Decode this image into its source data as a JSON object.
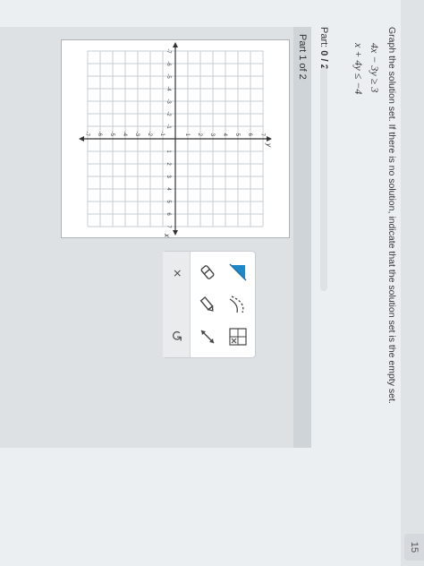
{
  "header": {
    "page_number": "15"
  },
  "question": {
    "instruction": "Graph the solution set. If there is no solution, indicate that the solution set is the empty set.",
    "inequality_1": "4x − 3y ≥ 3",
    "inequality_2": "x + 4y ≤ −4"
  },
  "part": {
    "label": "Part:",
    "progress": "0 / 2",
    "progress_fraction": 0,
    "current": "Part 1 of 2"
  },
  "graph": {
    "x_axis_label": "x",
    "y_axis_label": "y",
    "x_ticks": [
      "-7",
      "-6",
      "-5",
      "-4",
      "-3",
      "-2",
      "-1",
      "1",
      "2",
      "3",
      "4",
      "5",
      "6",
      "7"
    ],
    "y_ticks": [
      "7",
      "6",
      "5",
      "4",
      "3",
      "2",
      "1",
      "-1",
      "-2",
      "-3",
      "-4",
      "-5",
      "-6",
      "-7"
    ]
  },
  "tools": [
    {
      "name": "region-shade-icon"
    },
    {
      "name": "eraser-icon"
    },
    {
      "name": "dashed-boundary-icon"
    },
    {
      "name": "pencil-icon"
    },
    {
      "name": "empty-set-icon"
    },
    {
      "name": "line-draw-icon"
    }
  ],
  "actions": {
    "clear": "×",
    "undo": "↺"
  },
  "colors": {
    "accent": "#1e88c8",
    "panel": "#dde1e4",
    "grid": "#c7ccd1"
  }
}
